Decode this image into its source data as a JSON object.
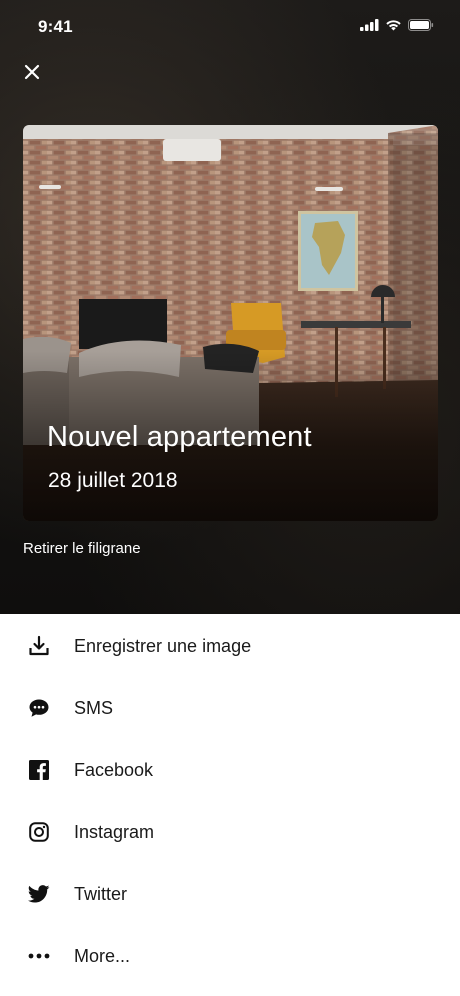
{
  "status_bar": {
    "time": "9:41"
  },
  "card": {
    "title": "Nouvel appartement",
    "date": "28 juillet 2018"
  },
  "watermark": {
    "label": "Retirer le filigrane"
  },
  "share": {
    "items": [
      {
        "label": "Enregistrer une image",
        "icon": "download-icon"
      },
      {
        "label": "SMS",
        "icon": "chat-bubble-icon"
      },
      {
        "label": "Facebook",
        "icon": "facebook-icon"
      },
      {
        "label": "Instagram",
        "icon": "instagram-icon"
      },
      {
        "label": "Twitter",
        "icon": "twitter-icon"
      },
      {
        "label": "More...",
        "icon": "more-dots-icon"
      }
    ]
  },
  "colors": {
    "sheet_bg": "#ffffff",
    "overlay_bg": "#151412",
    "text_dark": "#1a1a1a"
  }
}
